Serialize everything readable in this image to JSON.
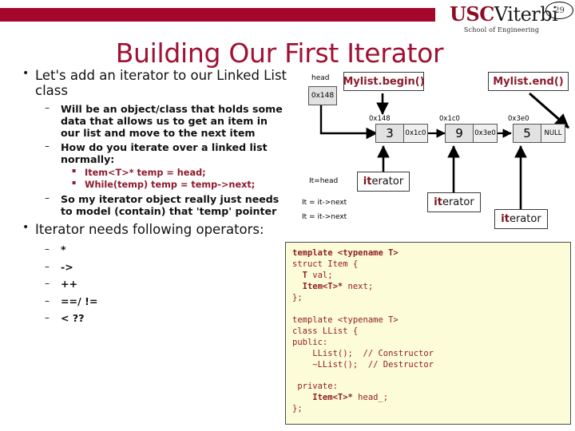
{
  "header": {
    "logo_usc": "USC",
    "logo_viterbi": "Viterbi",
    "logo_subtitle": "School of Engineering",
    "page_number": "29",
    "bar_color": "#a5062c"
  },
  "title": "Building Our First Iterator",
  "content": {
    "bullet1": "Let's add an iterator to our Linked List class",
    "sub1": "Will be an object/class that holds some data that allows us to get an item in our list and move to the next item",
    "sub2": "How do you iterate over a linked list normally:",
    "sub2_items": [
      "Item<T>* temp = head;",
      "While(temp) temp = temp->next;"
    ],
    "sub3": "So my iterator object really just needs to model (contain) that 'temp' pointer",
    "bullet2": "Iterator needs following operators:",
    "operators": [
      "*",
      "->",
      "++",
      "==/ !=",
      "< ??"
    ]
  },
  "diagram": {
    "head_label": "head",
    "head_value": "0x148",
    "begin_callout": "Mylist.begin()",
    "end_callout": "Mylist.end()",
    "nodes": [
      {
        "address": "0x148",
        "value": "3",
        "next": "0x1c0"
      },
      {
        "address": "0x1c0",
        "value": "9",
        "next": "0x3e0"
      },
      {
        "address": "0x3e0",
        "value": "5",
        "next": "NULL"
      }
    ],
    "step_labels": [
      "It=head",
      "It = it->next",
      "It = it->next"
    ],
    "iterator_boxes": [
      {
        "prefix": "it",
        "rest": "erator"
      },
      {
        "prefix": "it",
        "rest": "erator"
      },
      {
        "prefix": "it",
        "rest": "erator"
      }
    ]
  },
  "code": {
    "lines": [
      {
        "bold": "template <typename T>",
        "plain": ""
      },
      {
        "bold": "",
        "plain": "struct Item {"
      },
      {
        "bold": "  T",
        "plain": " val;"
      },
      {
        "bold": "  Item<T>*",
        "plain": " next;"
      },
      {
        "bold": "",
        "plain": "};"
      },
      {
        "bold": "",
        "plain": ""
      },
      {
        "bold": "",
        "plain": "template <typename T>"
      },
      {
        "bold": "",
        "plain": "class LList {"
      },
      {
        "bold": "",
        "plain": "public:"
      },
      {
        "bold": "",
        "plain": "    LList();  // Constructor"
      },
      {
        "bold": "",
        "plain": "    ~LList();  // Destructor"
      },
      {
        "bold": "",
        "plain": ""
      },
      {
        "bold": "",
        "plain": " private:"
      },
      {
        "bold": "    Item<T>*",
        "plain": " head_;"
      },
      {
        "bold": "",
        "plain": "};"
      }
    ]
  }
}
